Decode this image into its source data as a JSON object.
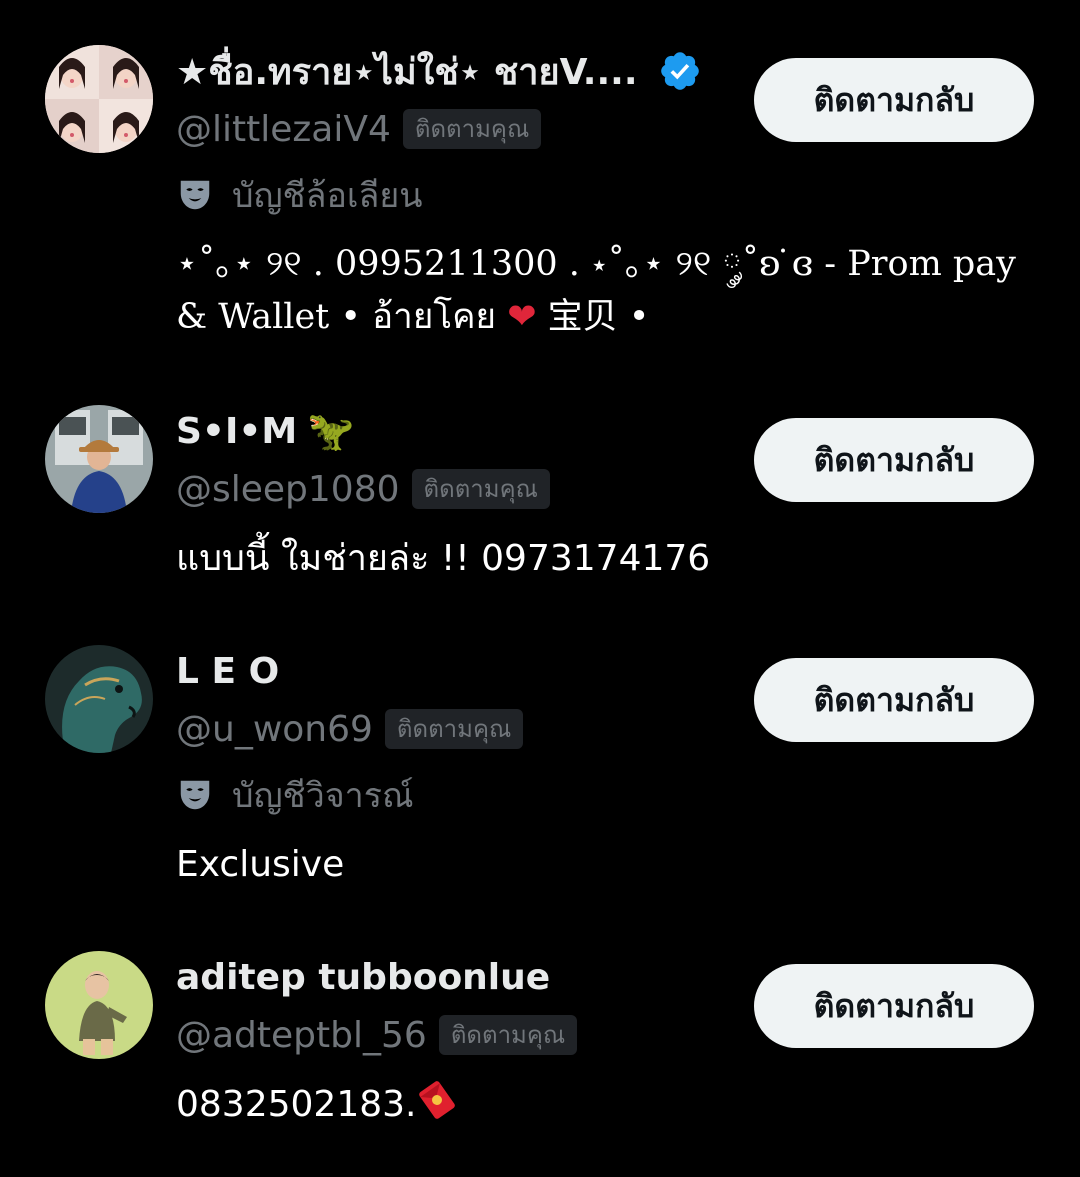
{
  "follow_back_label": "ติดตามกลับ",
  "follows_you_label": "ติดตามคุณ",
  "colors": {
    "background": "#000000",
    "primary_text": "#e7e9ea",
    "secondary_text": "#71767b",
    "button_bg": "#eff3f4",
    "button_text": "#0f1419",
    "verified_blue": "#1d9bf0"
  },
  "users": [
    {
      "display_name": "★ชื่อ.ทราย⋆ไม่ใช่⋆ ชายV....",
      "handle": "@littlezaiV4",
      "verified": true,
      "label_icon": "mask-icon",
      "account_label": "บัญชีล้อเลียน",
      "bio_line1": "⋆˚｡⋆ ୨୧ . 0995211300 . ⋆˚｡⋆ ୨୧ ༘˚ʚ ̇ɞ - Prom pay",
      "bio_line2_a": "& Wallet • อ้ายโคย",
      "bio_line2_b": "宝贝 •"
    },
    {
      "display_name": "S•I•M",
      "name_emoji": "🦖",
      "handle": "@sleep1080",
      "verified": false,
      "bio": "แบบนี้ ใมช่ายล่ะ !! 0973174176"
    },
    {
      "display_name": "L E O",
      "handle": "@u_won69",
      "verified": false,
      "label_icon": "mask-icon",
      "account_label": "บัญชีวิจารณ์",
      "bio": "Exclusive"
    },
    {
      "display_name": "aditep tubboonlue",
      "handle": "@adteptbl_56",
      "verified": false,
      "bio": "0832502183.",
      "bio_icon": "red-envelope-icon"
    }
  ]
}
